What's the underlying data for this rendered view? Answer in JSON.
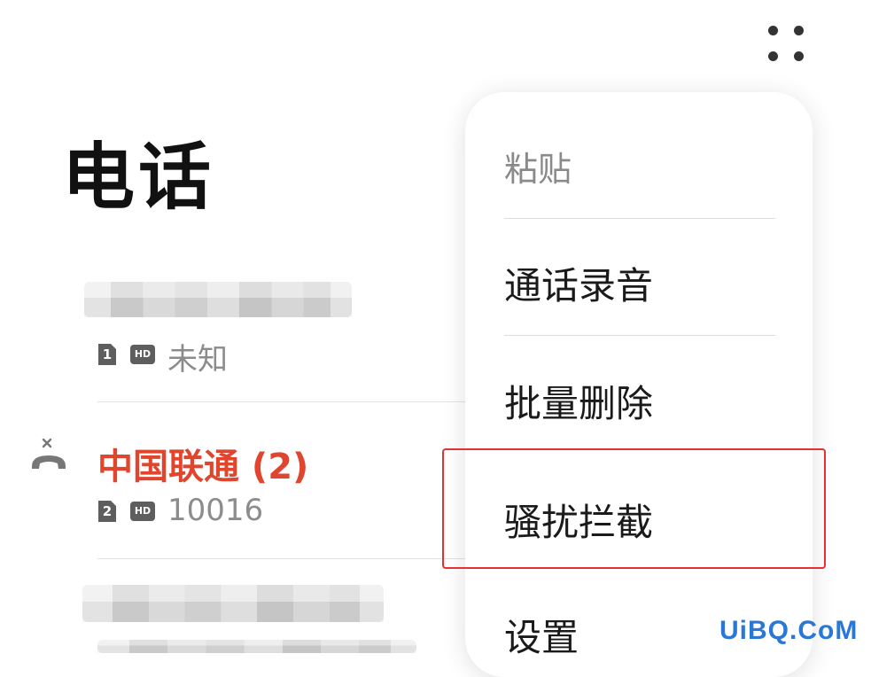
{
  "header": {
    "title": "电话"
  },
  "calls": [
    {
      "sim": "1",
      "hd": "HD",
      "subtitle": "未知"
    },
    {
      "name": "中国联通 (2)",
      "sim": "2",
      "hd": "HD",
      "subtitle": "10016"
    },
    {
      "number_partial": "1_0 2_1_ _",
      "subtitle_partial": "_ _ _ _ _ _ _ _ _"
    }
  ],
  "menu": {
    "items": [
      {
        "label": "粘贴",
        "enabled": false
      },
      {
        "label": "通话录音",
        "enabled": true
      },
      {
        "label": "批量删除",
        "enabled": true
      },
      {
        "label": "骚扰拦截",
        "enabled": true,
        "highlighted": true
      },
      {
        "label": "设置",
        "enabled": true
      }
    ]
  },
  "colors": {
    "missed_call_red": "#e0452e",
    "highlight_border": "#e23232",
    "watermark_blue": "#2a78d6"
  },
  "watermark": "UiBQ.CoM"
}
